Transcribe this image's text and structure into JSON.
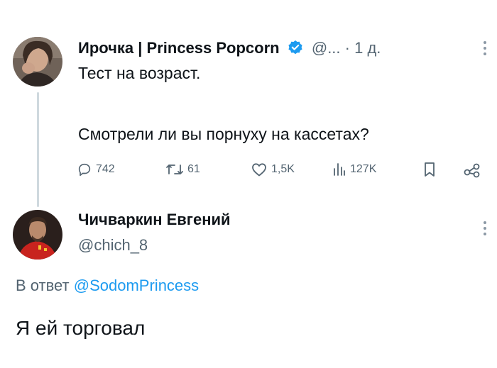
{
  "original_tweet": {
    "author_name": "Ирочка | Princess Popcorn",
    "handle": "@...",
    "separator": "·",
    "time": "1 д.",
    "line1": "Тест на возраст.",
    "line2": "Смотрели ли вы порнуху на кассетах?",
    "actions": {
      "replies": "742",
      "retweets": "61",
      "likes": "1,5K",
      "views": "127K"
    }
  },
  "reply_tweet": {
    "author_name": "Чичваркин Евгений",
    "handle": "@chich_8",
    "reply_prefix": "В ответ",
    "reply_to": "@SodomPrincess",
    "text": "Я ей торговал"
  },
  "colors": {
    "accent": "#1d9bf0",
    "muted": "#536471",
    "text": "#0f1419"
  }
}
